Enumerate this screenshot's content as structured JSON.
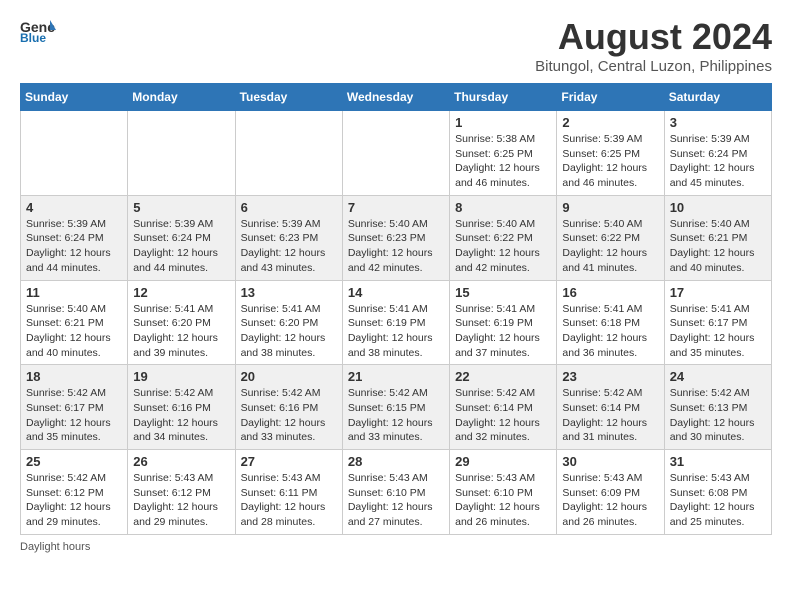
{
  "header": {
    "logo_general": "General",
    "logo_blue": "Blue",
    "title": "August 2024",
    "location": "Bitungol, Central Luzon, Philippines"
  },
  "days_of_week": [
    "Sunday",
    "Monday",
    "Tuesday",
    "Wednesday",
    "Thursday",
    "Friday",
    "Saturday"
  ],
  "weeks": [
    [
      {
        "day": "",
        "info": ""
      },
      {
        "day": "",
        "info": ""
      },
      {
        "day": "",
        "info": ""
      },
      {
        "day": "",
        "info": ""
      },
      {
        "day": "1",
        "info": "Sunrise: 5:38 AM\nSunset: 6:25 PM\nDaylight: 12 hours\nand 46 minutes."
      },
      {
        "day": "2",
        "info": "Sunrise: 5:39 AM\nSunset: 6:25 PM\nDaylight: 12 hours\nand 46 minutes."
      },
      {
        "day": "3",
        "info": "Sunrise: 5:39 AM\nSunset: 6:24 PM\nDaylight: 12 hours\nand 45 minutes."
      }
    ],
    [
      {
        "day": "4",
        "info": "Sunrise: 5:39 AM\nSunset: 6:24 PM\nDaylight: 12 hours\nand 44 minutes."
      },
      {
        "day": "5",
        "info": "Sunrise: 5:39 AM\nSunset: 6:24 PM\nDaylight: 12 hours\nand 44 minutes."
      },
      {
        "day": "6",
        "info": "Sunrise: 5:39 AM\nSunset: 6:23 PM\nDaylight: 12 hours\nand 43 minutes."
      },
      {
        "day": "7",
        "info": "Sunrise: 5:40 AM\nSunset: 6:23 PM\nDaylight: 12 hours\nand 42 minutes."
      },
      {
        "day": "8",
        "info": "Sunrise: 5:40 AM\nSunset: 6:22 PM\nDaylight: 12 hours\nand 42 minutes."
      },
      {
        "day": "9",
        "info": "Sunrise: 5:40 AM\nSunset: 6:22 PM\nDaylight: 12 hours\nand 41 minutes."
      },
      {
        "day": "10",
        "info": "Sunrise: 5:40 AM\nSunset: 6:21 PM\nDaylight: 12 hours\nand 40 minutes."
      }
    ],
    [
      {
        "day": "11",
        "info": "Sunrise: 5:40 AM\nSunset: 6:21 PM\nDaylight: 12 hours\nand 40 minutes."
      },
      {
        "day": "12",
        "info": "Sunrise: 5:41 AM\nSunset: 6:20 PM\nDaylight: 12 hours\nand 39 minutes."
      },
      {
        "day": "13",
        "info": "Sunrise: 5:41 AM\nSunset: 6:20 PM\nDaylight: 12 hours\nand 38 minutes."
      },
      {
        "day": "14",
        "info": "Sunrise: 5:41 AM\nSunset: 6:19 PM\nDaylight: 12 hours\nand 38 minutes."
      },
      {
        "day": "15",
        "info": "Sunrise: 5:41 AM\nSunset: 6:19 PM\nDaylight: 12 hours\nand 37 minutes."
      },
      {
        "day": "16",
        "info": "Sunrise: 5:41 AM\nSunset: 6:18 PM\nDaylight: 12 hours\nand 36 minutes."
      },
      {
        "day": "17",
        "info": "Sunrise: 5:41 AM\nSunset: 6:17 PM\nDaylight: 12 hours\nand 35 minutes."
      }
    ],
    [
      {
        "day": "18",
        "info": "Sunrise: 5:42 AM\nSunset: 6:17 PM\nDaylight: 12 hours\nand 35 minutes."
      },
      {
        "day": "19",
        "info": "Sunrise: 5:42 AM\nSunset: 6:16 PM\nDaylight: 12 hours\nand 34 minutes."
      },
      {
        "day": "20",
        "info": "Sunrise: 5:42 AM\nSunset: 6:16 PM\nDaylight: 12 hours\nand 33 minutes."
      },
      {
        "day": "21",
        "info": "Sunrise: 5:42 AM\nSunset: 6:15 PM\nDaylight: 12 hours\nand 33 minutes."
      },
      {
        "day": "22",
        "info": "Sunrise: 5:42 AM\nSunset: 6:14 PM\nDaylight: 12 hours\nand 32 minutes."
      },
      {
        "day": "23",
        "info": "Sunrise: 5:42 AM\nSunset: 6:14 PM\nDaylight: 12 hours\nand 31 minutes."
      },
      {
        "day": "24",
        "info": "Sunrise: 5:42 AM\nSunset: 6:13 PM\nDaylight: 12 hours\nand 30 minutes."
      }
    ],
    [
      {
        "day": "25",
        "info": "Sunrise: 5:42 AM\nSunset: 6:12 PM\nDaylight: 12 hours\nand 29 minutes."
      },
      {
        "day": "26",
        "info": "Sunrise: 5:43 AM\nSunset: 6:12 PM\nDaylight: 12 hours\nand 29 minutes."
      },
      {
        "day": "27",
        "info": "Sunrise: 5:43 AM\nSunset: 6:11 PM\nDaylight: 12 hours\nand 28 minutes."
      },
      {
        "day": "28",
        "info": "Sunrise: 5:43 AM\nSunset: 6:10 PM\nDaylight: 12 hours\nand 27 minutes."
      },
      {
        "day": "29",
        "info": "Sunrise: 5:43 AM\nSunset: 6:10 PM\nDaylight: 12 hours\nand 26 minutes."
      },
      {
        "day": "30",
        "info": "Sunrise: 5:43 AM\nSunset: 6:09 PM\nDaylight: 12 hours\nand 26 minutes."
      },
      {
        "day": "31",
        "info": "Sunrise: 5:43 AM\nSunset: 6:08 PM\nDaylight: 12 hours\nand 25 minutes."
      }
    ]
  ],
  "footer": {
    "daylight_hours_label": "Daylight hours"
  }
}
